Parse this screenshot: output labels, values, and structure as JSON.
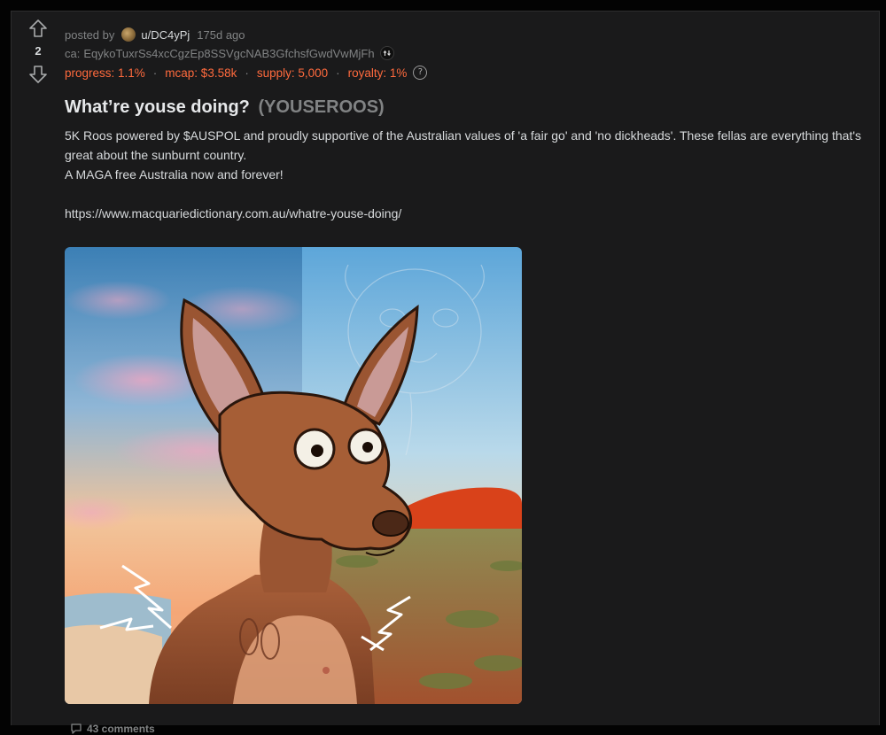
{
  "post": {
    "votes": "2",
    "meta": {
      "posted_by_label": "posted by",
      "author": "u/DC4yPj",
      "time": "175d ago"
    },
    "ca": {
      "label": "ca:",
      "value": "EqykoTuxrSs4xcCgzEp8SSVgcNAB3GfchsfGwdVwMjFh"
    },
    "stats": {
      "progress": "progress: 1.1%",
      "mcap": "mcap: $3.58k",
      "supply": "supply: 5,000",
      "royalty": "royalty: 1%",
      "separator": "·"
    },
    "title": "What’re youse doing?",
    "ticker": "(YOUSEROOS)",
    "body": {
      "line1": "5K Roos powered by $AUSPOL and proudly supportive of the Australian values of 'a fair go' and 'no dickheads'. These fellas are everything that's great about the sunburnt country.",
      "line2": "A MAGA free Australia now and forever!",
      "link": "https://www.macquariedictionary.com.au/whatre-youse-doing/"
    },
    "comments": "43 comments"
  },
  "colors": {
    "background": "#030303",
    "card": "#1a1a1b",
    "accent_orange": "#ff6a3d",
    "muted": "#818384",
    "text": "#d7dadc"
  },
  "icons": {
    "upvote": "arrow-up-icon",
    "downvote": "arrow-down-icon",
    "copy": "copy-icon",
    "help": "help-icon",
    "comment": "comment-icon"
  }
}
